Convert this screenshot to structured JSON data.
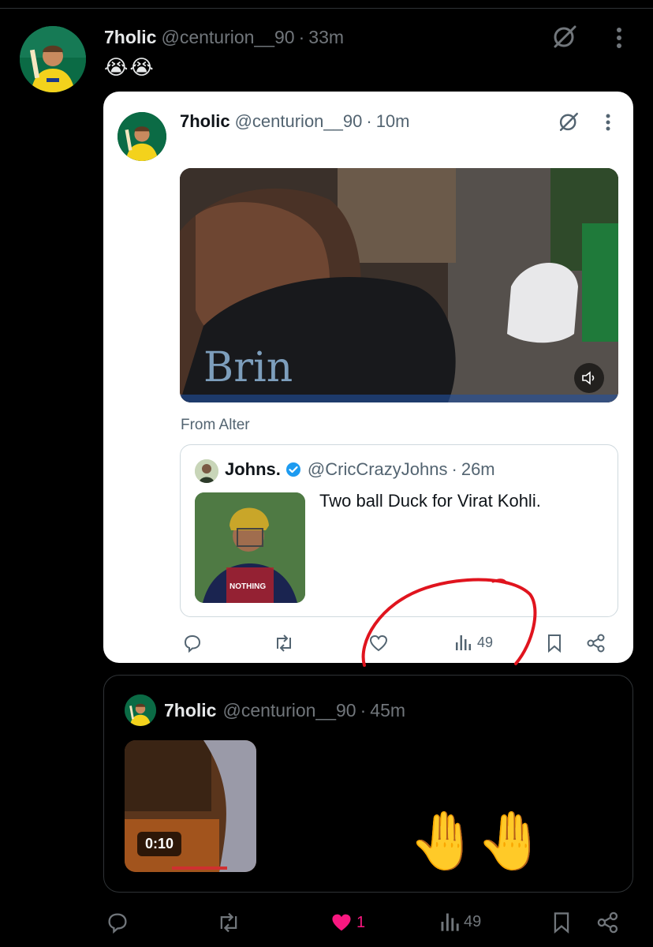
{
  "main_tweet": {
    "author_name": "7holic",
    "handle": "@centurion__90",
    "time": "33m",
    "text": "😭😭"
  },
  "quote_tweet": {
    "author_name": "7holic",
    "handle": "@centurion__90",
    "time": "10m",
    "video_icon": "volume-icon",
    "from_label": "From Alter",
    "embedded": {
      "author_name": "Johns.",
      "handle": "@CricCrazyJohns",
      "time": "26m",
      "text": "Two ball Duck for Virat Kohli.",
      "verified": true
    },
    "views": "49"
  },
  "second_quote": {
    "author_name": "7holic",
    "handle": "@centurion__90",
    "time": "45m",
    "video_duration": "0:10",
    "text": "🤚🤚"
  },
  "main_actions": {
    "likes": "1",
    "views": "49"
  },
  "colors": {
    "accent_like": "#f91880",
    "verified": "#1d9bf0",
    "annotation": "#e0141e"
  }
}
